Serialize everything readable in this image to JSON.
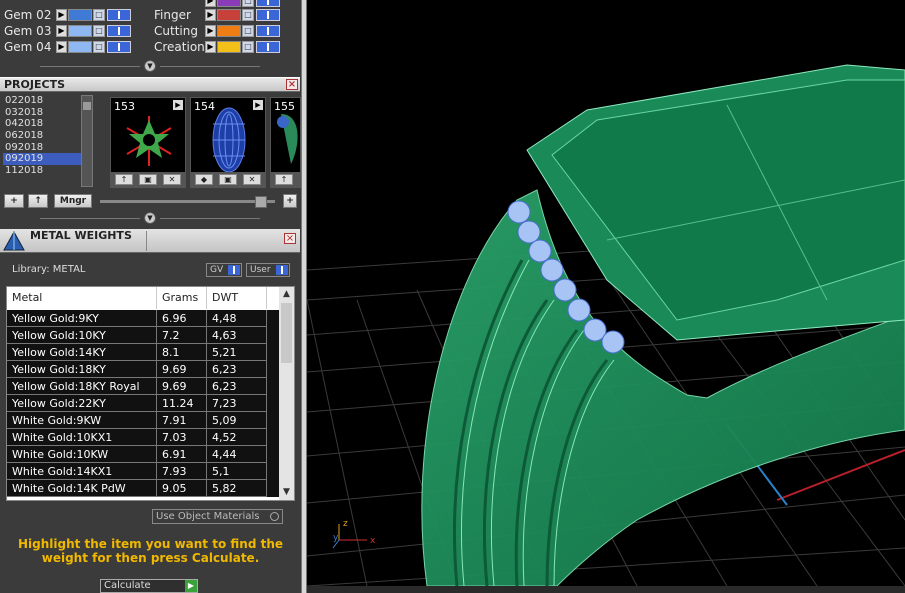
{
  "gems": {
    "rows": [
      {
        "label": "Gem 02",
        "color": "#3f7bd6"
      },
      {
        "label": "Gem 03",
        "color": "#8db8f2"
      },
      {
        "label": "Gem 04",
        "color": "#8db8f2"
      }
    ],
    "right_rows": [
      {
        "label": "Finger",
        "color": "#c8403a"
      },
      {
        "label": "Cutting",
        "color": "#f07d14"
      },
      {
        "label": "Creation",
        "color": "#f2c018"
      }
    ],
    "top_partial_right_color": "#8a3cb8"
  },
  "projects": {
    "title": "PROJECTS",
    "items": [
      "022018",
      "032018",
      "042018",
      "062018",
      "092018",
      "092019",
      "112018"
    ],
    "selected_index": 5,
    "thumbnails": [
      {
        "number": "153"
      },
      {
        "number": "154"
      },
      {
        "number": "155"
      }
    ],
    "buttons": {
      "add": "+",
      "up": "↑",
      "manager": "Mngr"
    }
  },
  "metal_weights": {
    "title": "METAL WEIGHTS",
    "library_label": "Library: METAL",
    "toggle_gv": "GV",
    "toggle_user": "User",
    "columns": [
      "Metal",
      "Grams",
      "DWT"
    ],
    "rows": [
      {
        "metal": "Yellow Gold:9KY",
        "grams": "6.96",
        "dwt": "4,48"
      },
      {
        "metal": "Yellow Gold:10KY",
        "grams": "7.2",
        "dwt": "4,63"
      },
      {
        "metal": "Yellow Gold:14KY",
        "grams": "8.1",
        "dwt": "5,21"
      },
      {
        "metal": "Yellow Gold:18KY",
        "grams": "9.69",
        "dwt": "6,23"
      },
      {
        "metal": "Yellow Gold:18KY Royal",
        "grams": "9.69",
        "dwt": "6,23"
      },
      {
        "metal": "Yellow Gold:22KY",
        "grams": "11.24",
        "dwt": "7,23"
      },
      {
        "metal": "White Gold:9KW",
        "grams": "7.91",
        "dwt": "5,09"
      },
      {
        "metal": "White Gold:10KX1",
        "grams": "7.03",
        "dwt": "4,52"
      },
      {
        "metal": "White Gold:10KW",
        "grams": "6.91",
        "dwt": "4,44"
      },
      {
        "metal": "White Gold:14KX1",
        "grams": "7.93",
        "dwt": "5,1"
      },
      {
        "metal": "White Gold:14K PdW",
        "grams": "9.05",
        "dwt": "5,82"
      }
    ],
    "use_object_materials": "Use Object Materials",
    "hint": "Highlight the item you want to find the weight for then press Calculate.",
    "calculate": "Calculate"
  },
  "viewport": {
    "background": "#000000",
    "ring_color": "#1f8f5c",
    "stone_color": "#a8c4f4",
    "axis_labels": {
      "z": "z",
      "y": "y",
      "x": "x"
    }
  }
}
